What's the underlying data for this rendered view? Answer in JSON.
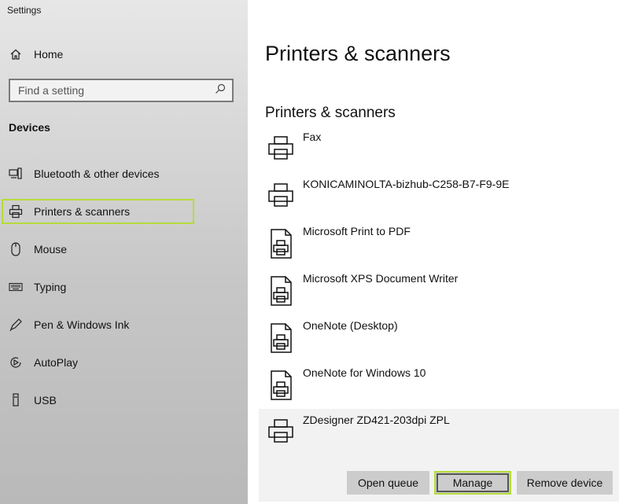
{
  "window": {
    "title": "Settings"
  },
  "sidebar": {
    "home_label": "Home",
    "search_placeholder": "Find a setting",
    "section_header": "Devices",
    "items": [
      {
        "label": "Bluetooth & other devices",
        "icon": "bluetooth-devices-icon"
      },
      {
        "label": "Printers & scanners",
        "icon": "printer-icon",
        "selected": true
      },
      {
        "label": "Mouse",
        "icon": "mouse-icon"
      },
      {
        "label": "Typing",
        "icon": "keyboard-icon"
      },
      {
        "label": "Pen & Windows Ink",
        "icon": "pen-icon"
      },
      {
        "label": "AutoPlay",
        "icon": "autoplay-icon"
      },
      {
        "label": "USB",
        "icon": "usb-icon"
      }
    ]
  },
  "main": {
    "page_title": "Printers & scanners",
    "section_title": "Printers & scanners",
    "devices": [
      {
        "name": "Fax",
        "icon": "printer-icon"
      },
      {
        "name": "KONICAMINOLTA-bizhub-C258-B7-F9-9E",
        "icon": "printer-icon"
      },
      {
        "name": "Microsoft Print to PDF",
        "icon": "document-printer-icon"
      },
      {
        "name": "Microsoft XPS Document Writer",
        "icon": "document-printer-icon"
      },
      {
        "name": "OneNote (Desktop)",
        "icon": "document-printer-icon"
      },
      {
        "name": "OneNote for Windows 10",
        "icon": "document-printer-icon"
      },
      {
        "name": "ZDesigner ZD421-203dpi ZPL",
        "icon": "printer-icon",
        "expanded": true
      }
    ],
    "buttons": {
      "open_queue": "Open queue",
      "manage": "Manage",
      "remove_device": "Remove device"
    }
  },
  "colors": {
    "highlight": "#b5dc3a",
    "sidebar_bg": "#c7c7c7",
    "button_bg": "#cccccc"
  }
}
